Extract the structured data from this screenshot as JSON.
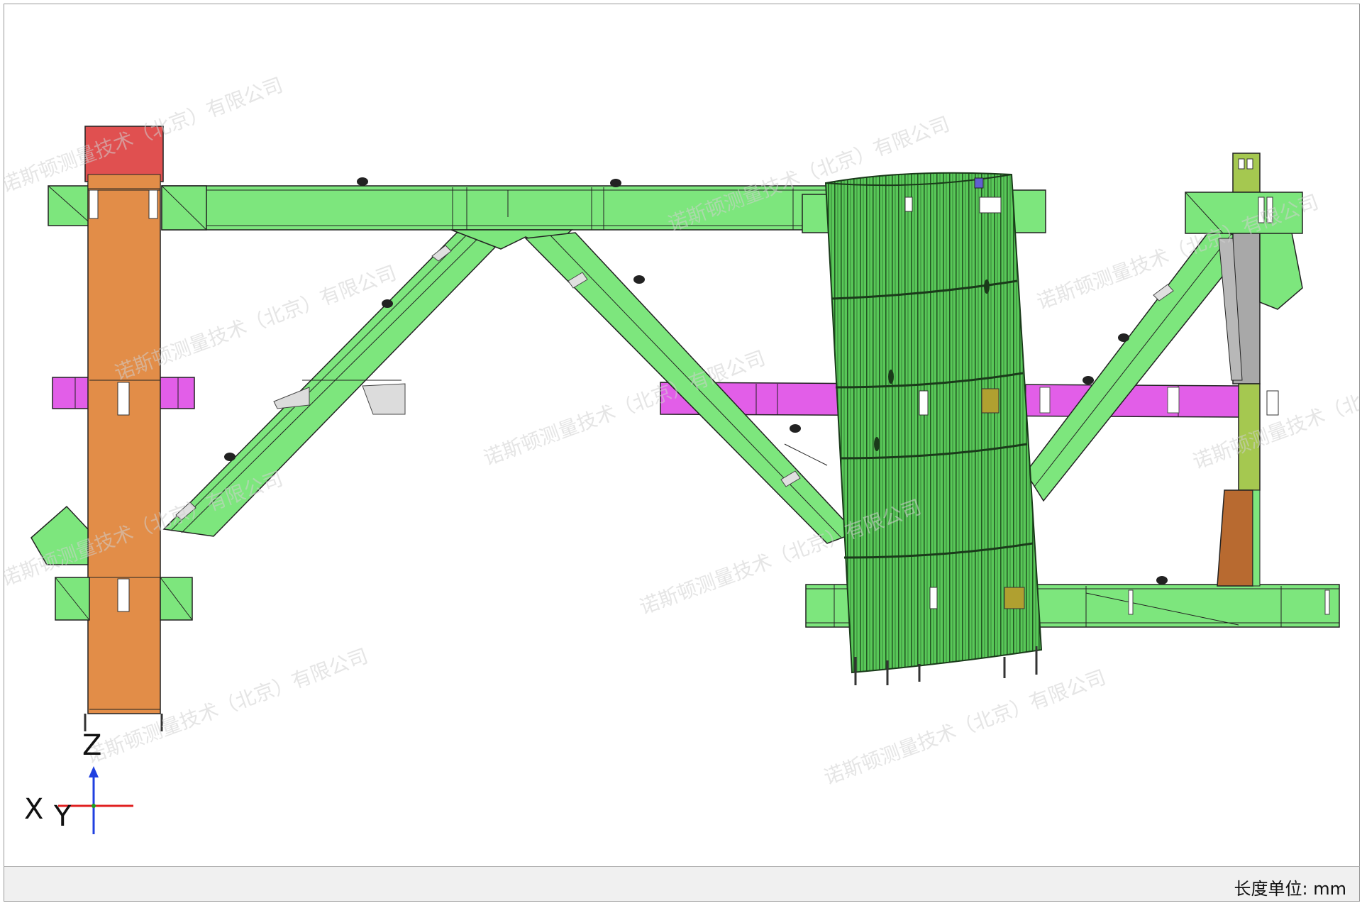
{
  "viewer": {
    "status_bar": {
      "unit_label": "长度单位: mm"
    },
    "axis_triad": {
      "labels": [
        "Z",
        "X",
        "Y"
      ]
    },
    "watermark": {
      "text": "诺斯顿测量技术（北京）有限公司"
    },
    "colors": {
      "beam_green": "#7de67d",
      "cylinder_green": "#53c453",
      "column_orange": "#e28d48",
      "cap_red": "#e05050",
      "crossbeam_magenta": "#e25ee8",
      "grey_part": "#a8a8a8",
      "olive_part": "#a5c850",
      "axis_x": "#e02020",
      "axis_y": "#20a020",
      "axis_z": "#2040e0"
    }
  }
}
